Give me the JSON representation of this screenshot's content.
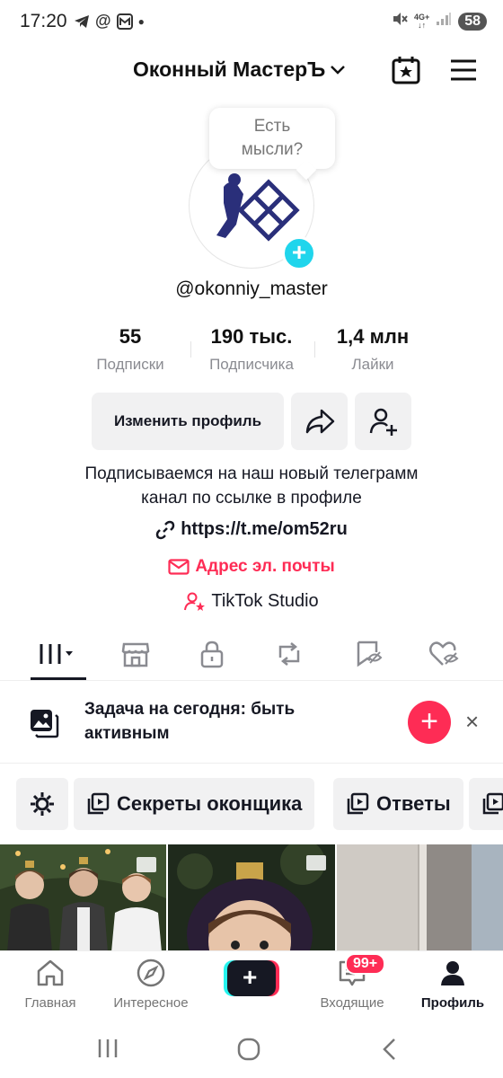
{
  "status": {
    "time": "17:20",
    "net_top": "4G+",
    "net_bottom": "↓↑",
    "battery": "58"
  },
  "header": {
    "account_name": "Оконный МастерЪ"
  },
  "profile": {
    "bubble_line1": "Есть",
    "bubble_line2": "мысли?",
    "username": "@okonniy_master"
  },
  "stats": [
    {
      "value": "55",
      "label": "Подписки"
    },
    {
      "value": "190 тыс.",
      "label": "Подписчика"
    },
    {
      "value": "1,4 млн",
      "label": "Лайки"
    }
  ],
  "actions": {
    "edit_profile": "Изменить профиль"
  },
  "bio": {
    "line1": "Подписываемся на наш новый телеграмм",
    "line2": "канал по ссылке в профиле"
  },
  "links": {
    "url": "https://t.me/om52ru",
    "email": "Адрес эл. почты",
    "studio": "TikTok Studio"
  },
  "task": {
    "line1": "Задача на сегодня: быть",
    "line2": "активным",
    "plus": "+",
    "close": "×"
  },
  "chips": [
    {
      "label": "Секреты оконщика"
    },
    {
      "label": "Ответы"
    }
  ],
  "bottom_nav": [
    {
      "label": "Главная"
    },
    {
      "label": "Интересное"
    },
    {
      "label": "Входящие"
    },
    {
      "label": "Профиль"
    }
  ],
  "inbox_badge": "99+",
  "create_label": "+",
  "colors": {
    "accent": "#fe2c55",
    "cyan": "#20d5ec",
    "text": "#161823",
    "muted": "#8a8b91",
    "button_bg": "#f1f1f2"
  }
}
